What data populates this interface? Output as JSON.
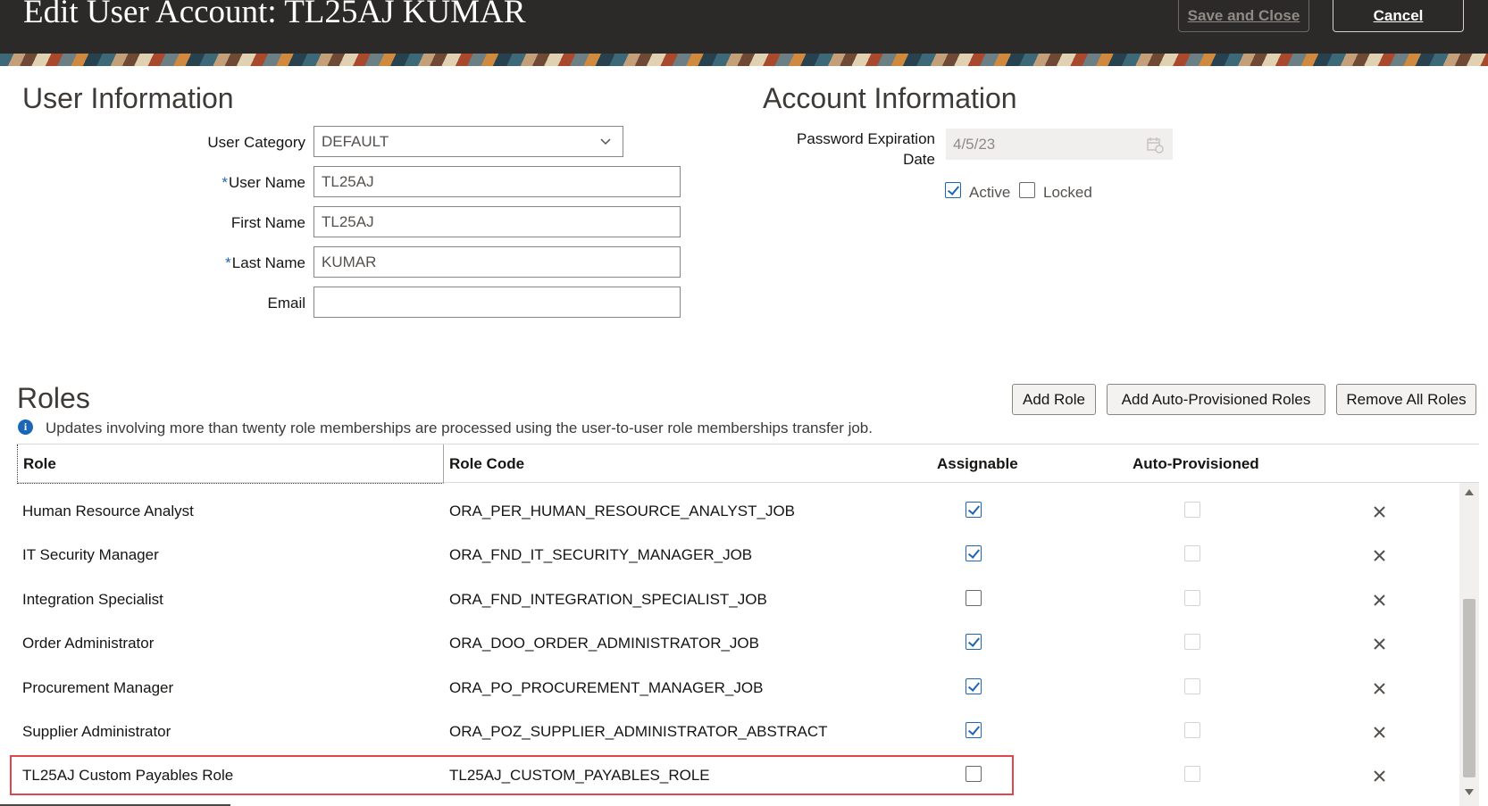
{
  "header": {
    "title": "Edit User Account: TL25AJ KUMAR",
    "save_close_label": "Save and Close",
    "cancel_label": "Cancel"
  },
  "user_information": {
    "heading": "User Information",
    "user_category": {
      "label": "User Category",
      "value": "DEFAULT"
    },
    "user_name": {
      "required_mark": "*",
      "label": "User Name",
      "value": "TL25AJ"
    },
    "first_name": {
      "label": "First Name",
      "value": "TL25AJ"
    },
    "last_name": {
      "required_mark": "*",
      "label": "Last Name",
      "value": "KUMAR"
    },
    "email": {
      "label": "Email",
      "value": ""
    }
  },
  "account_information": {
    "heading": "Account Information",
    "password_expiration": {
      "label_line1": "Password Expiration",
      "label_line2": "Date",
      "value": "4/5/23"
    },
    "active": {
      "label": "Active",
      "checked": true
    },
    "locked": {
      "label": "Locked",
      "checked": false
    }
  },
  "roles": {
    "heading": "Roles",
    "add_role_label": "Add Role",
    "add_auto_label": "Add Auto-Provisioned Roles",
    "remove_all_label": "Remove All Roles",
    "info_text": "Updates involving more than twenty role memberships are processed using the user-to-user role memberships transfer job.",
    "columns": {
      "role": "Role",
      "role_code": "Role Code",
      "assignable": "Assignable",
      "auto_provisioned": "Auto-Provisioned"
    },
    "rows": [
      {
        "role": "Human Resource Analyst",
        "code": "ORA_PER_HUMAN_RESOURCE_ANALYST_JOB",
        "assignable": true,
        "auto": false
      },
      {
        "role": "IT Security Manager",
        "code": "ORA_FND_IT_SECURITY_MANAGER_JOB",
        "assignable": true,
        "auto": false
      },
      {
        "role": "Integration Specialist",
        "code": "ORA_FND_INTEGRATION_SPECIALIST_JOB",
        "assignable": false,
        "auto": false
      },
      {
        "role": "Order Administrator",
        "code": "ORA_DOO_ORDER_ADMINISTRATOR_JOB",
        "assignable": true,
        "auto": false
      },
      {
        "role": "Procurement Manager",
        "code": "ORA_PO_PROCUREMENT_MANAGER_JOB",
        "assignable": true,
        "auto": false
      },
      {
        "role": "Supplier Administrator",
        "code": "ORA_POZ_SUPPLIER_ADMINISTRATOR_ABSTRACT",
        "assignable": true,
        "auto": false
      },
      {
        "role": "TL25AJ Custom Payables Role",
        "code": "TL25AJ_CUSTOM_PAYABLES_ROLE",
        "assignable": false,
        "auto": false
      }
    ]
  },
  "colors": {
    "header_bg": "#2c2a28",
    "accent_blue": "#1c66b6",
    "highlight_red": "#e0474c"
  },
  "icons": [
    "chevron-down-icon",
    "calendar-icon",
    "info-icon",
    "close-icon"
  ]
}
